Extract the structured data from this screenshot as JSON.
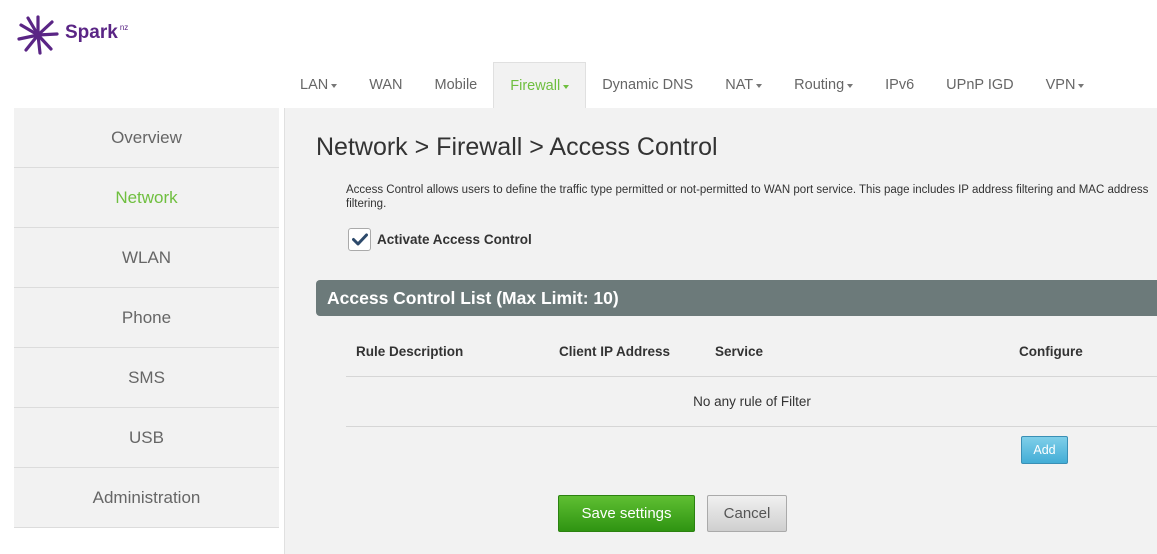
{
  "brand": {
    "name": "Spark",
    "suffix": "nz",
    "color": "#5a2585"
  },
  "topnav": {
    "tabs": [
      {
        "label": "LAN",
        "dropdown": true
      },
      {
        "label": "WAN",
        "dropdown": false
      },
      {
        "label": "Mobile",
        "dropdown": false
      },
      {
        "label": "Firewall",
        "dropdown": true,
        "active": true
      },
      {
        "label": "Dynamic DNS",
        "dropdown": false
      },
      {
        "label": "NAT",
        "dropdown": true
      },
      {
        "label": "Routing",
        "dropdown": true
      },
      {
        "label": "IPv6",
        "dropdown": false
      },
      {
        "label": "UPnP IGD",
        "dropdown": false
      },
      {
        "label": "VPN",
        "dropdown": true
      }
    ]
  },
  "sidebar": {
    "items": [
      {
        "label": "Overview"
      },
      {
        "label": "Network",
        "active": true
      },
      {
        "label": "WLAN"
      },
      {
        "label": "Phone"
      },
      {
        "label": "SMS"
      },
      {
        "label": "USB"
      },
      {
        "label": "Administration"
      }
    ]
  },
  "page": {
    "title": "Network > Firewall > Access Control",
    "description": "Access Control allows users to define the traffic type permitted or not-permitted to WAN port service. This page includes IP address filtering and MAC address filtering.",
    "activate_label": "Activate Access Control",
    "activate_checked": true
  },
  "access_list": {
    "header": "Access Control List (Max Limit: 10)",
    "columns": [
      "Rule Description",
      "Client IP Address",
      "Service",
      "Configure"
    ],
    "empty_message": "No any rule of Filter",
    "add_label": "Add"
  },
  "actions": {
    "save_label": "Save settings",
    "cancel_label": "Cancel"
  },
  "colors": {
    "accent_green": "#6fbf3f",
    "header_gray": "#6c7a7a",
    "add_blue": "#43add6",
    "save_green": "#2f9412"
  }
}
